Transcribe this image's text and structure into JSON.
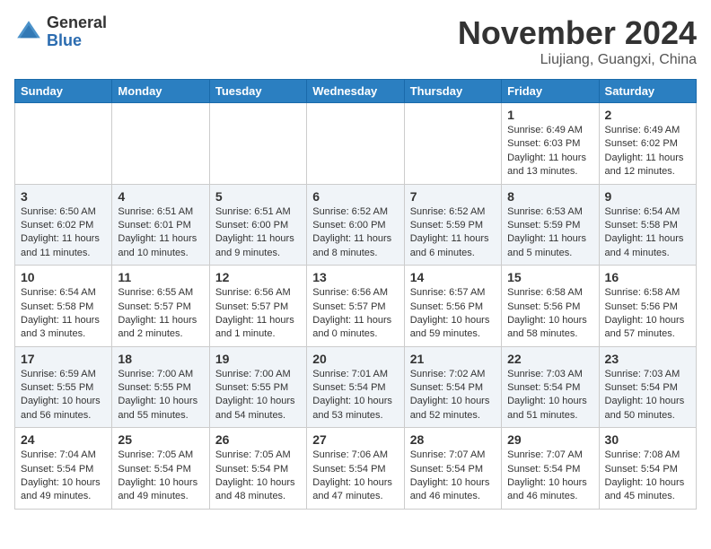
{
  "header": {
    "logo_general": "General",
    "logo_blue": "Blue",
    "title": "November 2024",
    "subtitle": "Liujiang, Guangxi, China"
  },
  "weekdays": [
    "Sunday",
    "Monday",
    "Tuesday",
    "Wednesday",
    "Thursday",
    "Friday",
    "Saturday"
  ],
  "weeks": [
    [
      {
        "day": "",
        "info": ""
      },
      {
        "day": "",
        "info": ""
      },
      {
        "day": "",
        "info": ""
      },
      {
        "day": "",
        "info": ""
      },
      {
        "day": "",
        "info": ""
      },
      {
        "day": "1",
        "info": "Sunrise: 6:49 AM\nSunset: 6:03 PM\nDaylight: 11 hours and 13 minutes."
      },
      {
        "day": "2",
        "info": "Sunrise: 6:49 AM\nSunset: 6:02 PM\nDaylight: 11 hours and 12 minutes."
      }
    ],
    [
      {
        "day": "3",
        "info": "Sunrise: 6:50 AM\nSunset: 6:02 PM\nDaylight: 11 hours and 11 minutes."
      },
      {
        "day": "4",
        "info": "Sunrise: 6:51 AM\nSunset: 6:01 PM\nDaylight: 11 hours and 10 minutes."
      },
      {
        "day": "5",
        "info": "Sunrise: 6:51 AM\nSunset: 6:00 PM\nDaylight: 11 hours and 9 minutes."
      },
      {
        "day": "6",
        "info": "Sunrise: 6:52 AM\nSunset: 6:00 PM\nDaylight: 11 hours and 8 minutes."
      },
      {
        "day": "7",
        "info": "Sunrise: 6:52 AM\nSunset: 5:59 PM\nDaylight: 11 hours and 6 minutes."
      },
      {
        "day": "8",
        "info": "Sunrise: 6:53 AM\nSunset: 5:59 PM\nDaylight: 11 hours and 5 minutes."
      },
      {
        "day": "9",
        "info": "Sunrise: 6:54 AM\nSunset: 5:58 PM\nDaylight: 11 hours and 4 minutes."
      }
    ],
    [
      {
        "day": "10",
        "info": "Sunrise: 6:54 AM\nSunset: 5:58 PM\nDaylight: 11 hours and 3 minutes."
      },
      {
        "day": "11",
        "info": "Sunrise: 6:55 AM\nSunset: 5:57 PM\nDaylight: 11 hours and 2 minutes."
      },
      {
        "day": "12",
        "info": "Sunrise: 6:56 AM\nSunset: 5:57 PM\nDaylight: 11 hours and 1 minute."
      },
      {
        "day": "13",
        "info": "Sunrise: 6:56 AM\nSunset: 5:57 PM\nDaylight: 11 hours and 0 minutes."
      },
      {
        "day": "14",
        "info": "Sunrise: 6:57 AM\nSunset: 5:56 PM\nDaylight: 10 hours and 59 minutes."
      },
      {
        "day": "15",
        "info": "Sunrise: 6:58 AM\nSunset: 5:56 PM\nDaylight: 10 hours and 58 minutes."
      },
      {
        "day": "16",
        "info": "Sunrise: 6:58 AM\nSunset: 5:56 PM\nDaylight: 10 hours and 57 minutes."
      }
    ],
    [
      {
        "day": "17",
        "info": "Sunrise: 6:59 AM\nSunset: 5:55 PM\nDaylight: 10 hours and 56 minutes."
      },
      {
        "day": "18",
        "info": "Sunrise: 7:00 AM\nSunset: 5:55 PM\nDaylight: 10 hours and 55 minutes."
      },
      {
        "day": "19",
        "info": "Sunrise: 7:00 AM\nSunset: 5:55 PM\nDaylight: 10 hours and 54 minutes."
      },
      {
        "day": "20",
        "info": "Sunrise: 7:01 AM\nSunset: 5:54 PM\nDaylight: 10 hours and 53 minutes."
      },
      {
        "day": "21",
        "info": "Sunrise: 7:02 AM\nSunset: 5:54 PM\nDaylight: 10 hours and 52 minutes."
      },
      {
        "day": "22",
        "info": "Sunrise: 7:03 AM\nSunset: 5:54 PM\nDaylight: 10 hours and 51 minutes."
      },
      {
        "day": "23",
        "info": "Sunrise: 7:03 AM\nSunset: 5:54 PM\nDaylight: 10 hours and 50 minutes."
      }
    ],
    [
      {
        "day": "24",
        "info": "Sunrise: 7:04 AM\nSunset: 5:54 PM\nDaylight: 10 hours and 49 minutes."
      },
      {
        "day": "25",
        "info": "Sunrise: 7:05 AM\nSunset: 5:54 PM\nDaylight: 10 hours and 49 minutes."
      },
      {
        "day": "26",
        "info": "Sunrise: 7:05 AM\nSunset: 5:54 PM\nDaylight: 10 hours and 48 minutes."
      },
      {
        "day": "27",
        "info": "Sunrise: 7:06 AM\nSunset: 5:54 PM\nDaylight: 10 hours and 47 minutes."
      },
      {
        "day": "28",
        "info": "Sunrise: 7:07 AM\nSunset: 5:54 PM\nDaylight: 10 hours and 46 minutes."
      },
      {
        "day": "29",
        "info": "Sunrise: 7:07 AM\nSunset: 5:54 PM\nDaylight: 10 hours and 46 minutes."
      },
      {
        "day": "30",
        "info": "Sunrise: 7:08 AM\nSunset: 5:54 PM\nDaylight: 10 hours and 45 minutes."
      }
    ]
  ]
}
